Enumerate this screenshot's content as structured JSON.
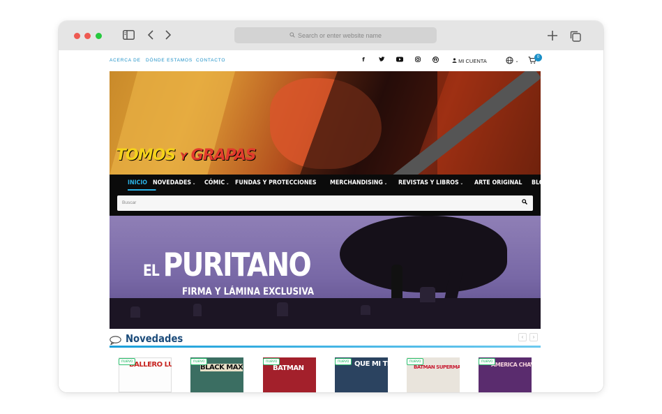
{
  "browser": {
    "url_placeholder": "Search or enter website name"
  },
  "topbar": {
    "links": [
      "ACERCA DE",
      "DÓNDE ESTAMOS",
      "CONTACTO"
    ],
    "social_icons": [
      "facebook-icon",
      "twitter-icon",
      "youtube-icon",
      "instagram-icon",
      "wordpress-icon"
    ],
    "account_label": "MI CUENTA",
    "cart_count": "0"
  },
  "hero": {
    "logo_word1": "TOMOS",
    "logo_word2": "Y",
    "logo_word3": "GRAPAS"
  },
  "nav": {
    "items": [
      {
        "label": "INICIO",
        "active": true
      },
      {
        "label": "NOVEDADES",
        "dropdown": true
      },
      {
        "label": "CÓMIC",
        "dropdown": true
      },
      {
        "label": "FUNDAS Y PROTECCIONES"
      },
      {
        "label": "MERCHANDISING",
        "dropdown": true
      },
      {
        "label": "REVISTAS Y LIBROS",
        "dropdown": true
      },
      {
        "label": "ARTE ORIGINAL"
      },
      {
        "label": "BLOG TYG"
      }
    ],
    "search_placeholder": "Buscar"
  },
  "banner": {
    "title_prefix": "EL",
    "title_main": "PURITANO",
    "subtitle": "FIRMA Y LÁMINA EXCLUSIVA"
  },
  "section": {
    "title": "Novedades"
  },
  "products": [
    {
      "badge": "nuevo",
      "cover_text": "BALLERO LUNA",
      "color": "#c7231f",
      "bg": "#fdfdfd"
    },
    {
      "badge": "nuevo",
      "cover_text": "BLACK MAX",
      "color": "#111111",
      "bg": "#3b6e62"
    },
    {
      "badge": "nuevo",
      "cover_text": "BATMAN",
      "color": "#ffffff",
      "bg": "#a3202b"
    },
    {
      "badge": "nuevo",
      "cover_text": "QUE MI TE",
      "color": "#ffffff",
      "bg": "#2b4360"
    },
    {
      "badge": "nuevo",
      "cover_text": "BATMAN SUPERMAN",
      "color": "#c81b32",
      "bg": "#e9e4dc"
    },
    {
      "badge": "nuevo",
      "cover_text": "AMERICA CHAVEZ",
      "color": "#f2d0da",
      "bg": "#5a2c6e"
    }
  ],
  "colors": {
    "accent": "#1a8fc7",
    "nav_bg": "#0b0b0b",
    "section_title": "#1b4b7a",
    "badge": "#2bbf6d"
  }
}
